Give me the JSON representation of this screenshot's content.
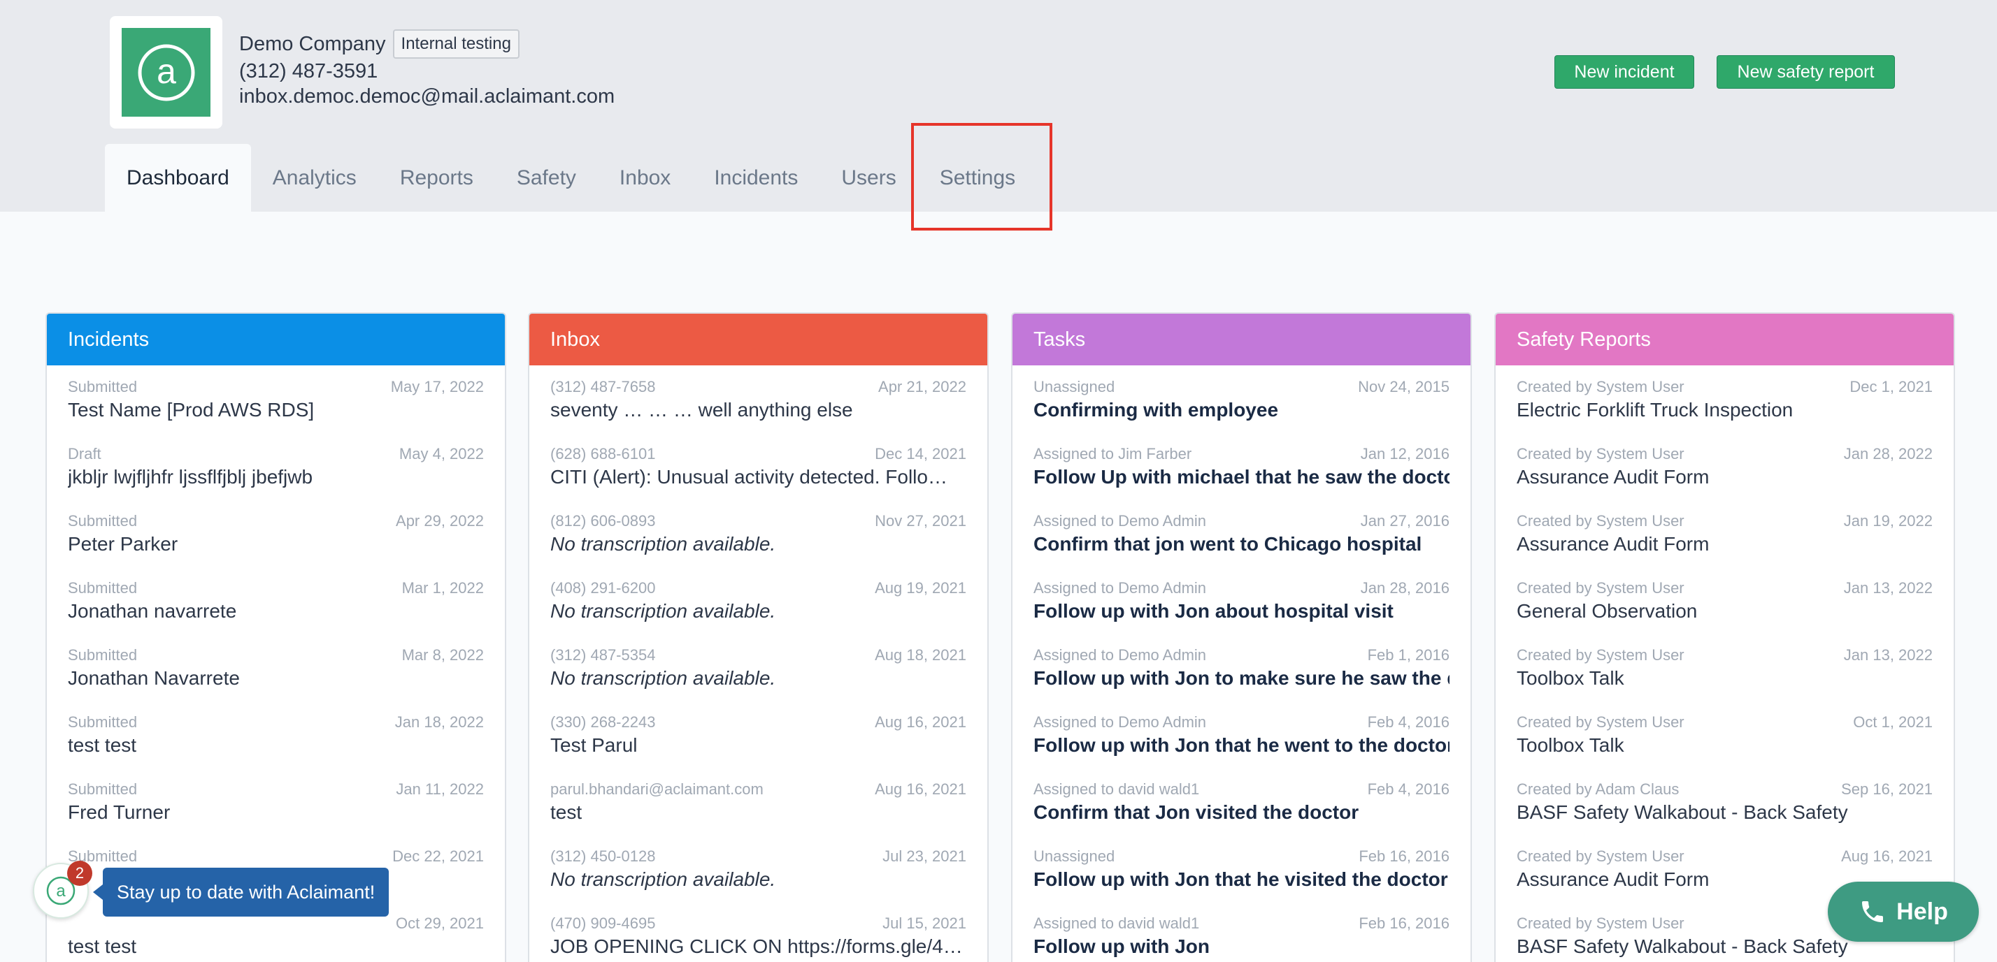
{
  "company": {
    "name": "Demo Company",
    "badge": "Internal testing",
    "phone": "(312) 487-3591",
    "email": "inbox.democ.democ@mail.aclaimant.com"
  },
  "header_buttons": {
    "new_incident": "New incident",
    "new_safety_report": "New safety report"
  },
  "nav": {
    "dashboard": "Dashboard",
    "analytics": "Analytics",
    "reports": "Reports",
    "safety": "Safety",
    "inbox": "Inbox",
    "incidents": "Incidents",
    "users": "Users",
    "settings": "Settings"
  },
  "panels": {
    "incidents": {
      "title": "Incidents",
      "color": "#0b8fe6",
      "items": [
        {
          "meta": "Submitted",
          "date": "May 17, 2022",
          "title": "Test Name [Prod AWS RDS]"
        },
        {
          "meta": "Draft",
          "date": "May 4, 2022",
          "title": "jkbljr lwjfljhfr ljssflfjblj jbefjwb"
        },
        {
          "meta": "Submitted",
          "date": "Apr 29, 2022",
          "title": "Peter Parker"
        },
        {
          "meta": "Submitted",
          "date": "Mar 1, 2022",
          "title": "Jonathan navarrete"
        },
        {
          "meta": "Submitted",
          "date": "Mar 8, 2022",
          "title": "Jonathan Navarrete"
        },
        {
          "meta": "Submitted",
          "date": "Jan 18, 2022",
          "title": "test test"
        },
        {
          "meta": "Submitted",
          "date": "Jan 11, 2022",
          "title": "Fred Turner"
        },
        {
          "meta": "Submitted",
          "date": "Dec 22, 2021",
          "title": ""
        },
        {
          "meta": "",
          "date": "Oct 29, 2021",
          "title": "test test"
        }
      ]
    },
    "inbox": {
      "title": "Inbox",
      "color": "#ec5a44",
      "items": [
        {
          "meta": "(312) 487-7658",
          "date": "Apr 21, 2022",
          "title": "seventy … … … well anything else"
        },
        {
          "meta": "(628) 688-6101",
          "date": "Dec 14, 2021",
          "title": "CITI (Alert): Unusual activity detected. Follo…"
        },
        {
          "meta": "(812) 606-0893",
          "date": "Nov 27, 2021",
          "title": "No transcription available."
        },
        {
          "meta": "(408) 291-6200",
          "date": "Aug 19, 2021",
          "title": "No transcription available."
        },
        {
          "meta": "(312) 487-5354",
          "date": "Aug 18, 2021",
          "title": "No transcription available."
        },
        {
          "meta": "(330) 268-2243",
          "date": "Aug 16, 2021",
          "title": "Test Parul"
        },
        {
          "meta": "parul.bhandari@aclaimant.com",
          "date": "Aug 16, 2021",
          "title": "test"
        },
        {
          "meta": "(312) 450-0128",
          "date": "Jul 23, 2021",
          "title": "No transcription available."
        },
        {
          "meta": "(470) 909-4695",
          "date": "Jul 15, 2021",
          "title": "JOB OPENING CLICK ON https://forms.gle/4…"
        }
      ]
    },
    "tasks": {
      "title": "Tasks",
      "color": "#c278d9",
      "items": [
        {
          "meta": "Unassigned",
          "date": "Nov 24, 2015",
          "title": "Confirming with employee"
        },
        {
          "meta": "Assigned to Jim Farber",
          "date": "Jan 12, 2016",
          "title": "Follow Up with michael that he saw the docto"
        },
        {
          "meta": "Assigned to Demo Admin",
          "date": "Jan 27, 2016",
          "title": "Confirm that jon went to Chicago hospital"
        },
        {
          "meta": "Assigned to Demo Admin",
          "date": "Jan 28, 2016",
          "title": "Follow up with Jon about hospital visit"
        },
        {
          "meta": "Assigned to Demo Admin",
          "date": "Feb 1, 2016",
          "title": "Follow up with Jon to make sure he saw the d"
        },
        {
          "meta": "Assigned to Demo Admin",
          "date": "Feb 4, 2016",
          "title": "Follow up with Jon that he went to the doctor"
        },
        {
          "meta": "Assigned to david wald1",
          "date": "Feb 4, 2016",
          "title": "Confirm that Jon visited the doctor"
        },
        {
          "meta": "Unassigned",
          "date": "Feb 16, 2016",
          "title": "Follow up with Jon that he visited the doctor"
        },
        {
          "meta": "Assigned to david wald1",
          "date": "Feb 16, 2016",
          "title": "Follow up with Jon"
        }
      ]
    },
    "safety": {
      "title": "Safety Reports",
      "color": "#e277c4",
      "items": [
        {
          "meta": "Created by System User",
          "date": "Dec 1, 2021",
          "title": "Electric Forklift Truck Inspection"
        },
        {
          "meta": "Created by System User",
          "date": "Jan 28, 2022",
          "title": "Assurance Audit Form"
        },
        {
          "meta": "Created by System User",
          "date": "Jan 19, 2022",
          "title": "Assurance Audit Form"
        },
        {
          "meta": "Created by System User",
          "date": "Jan 13, 2022",
          "title": "General Observation"
        },
        {
          "meta": "Created by System User",
          "date": "Jan 13, 2022",
          "title": "Toolbox Talk"
        },
        {
          "meta": "Created by System User",
          "date": "Oct 1, 2021",
          "title": "Toolbox Talk"
        },
        {
          "meta": "Created by Adam Claus",
          "date": "Sep 16, 2021",
          "title": "BASF Safety Walkabout - Back Safety"
        },
        {
          "meta": "Created by System User",
          "date": "Aug 16, 2021",
          "title": "Assurance Audit Form"
        },
        {
          "meta": "Created by System User",
          "date": "",
          "title": "BASF Safety Walkabout - Back Safety"
        }
      ]
    }
  },
  "widget": {
    "badge_count": "2",
    "tooltip": "Stay up to date with Aclaimant!"
  },
  "help": {
    "label": "Help"
  }
}
